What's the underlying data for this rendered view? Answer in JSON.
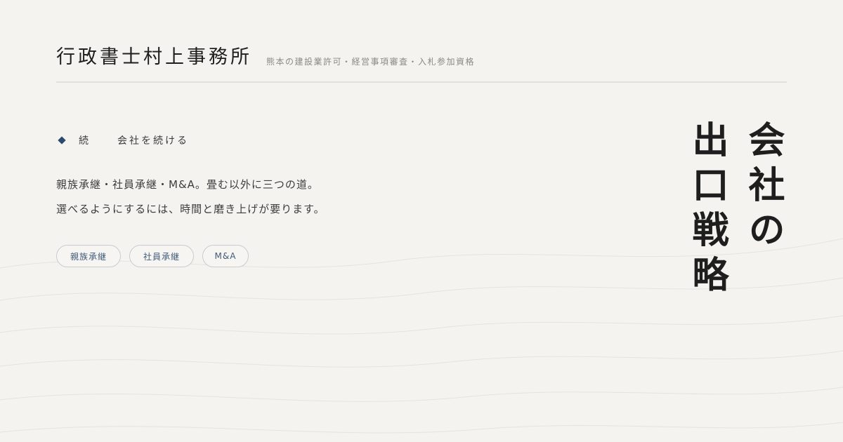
{
  "header": {
    "office_name": "行政書士村上事務所",
    "tagline": "熊本の建設業許可・経営事項審査・入札参加資格"
  },
  "eyebrow": {
    "icon": "diamond-icon",
    "key": "続",
    "label": "会社を続ける"
  },
  "body": {
    "line1": "親族承継・社員承継・M&A。畳む以外に三つの道。",
    "line2": "選べるようにするには、時間と磨き上げが要ります。"
  },
  "tags": [
    "親族承継",
    "社員承継",
    "M&A"
  ],
  "title": {
    "text": "会社の\n出口戦略"
  },
  "colors": {
    "background": "#f4f3ef",
    "accent": "#2d4a6b",
    "tag_text": "#3f5a78",
    "divider": "#e2e1dd"
  }
}
